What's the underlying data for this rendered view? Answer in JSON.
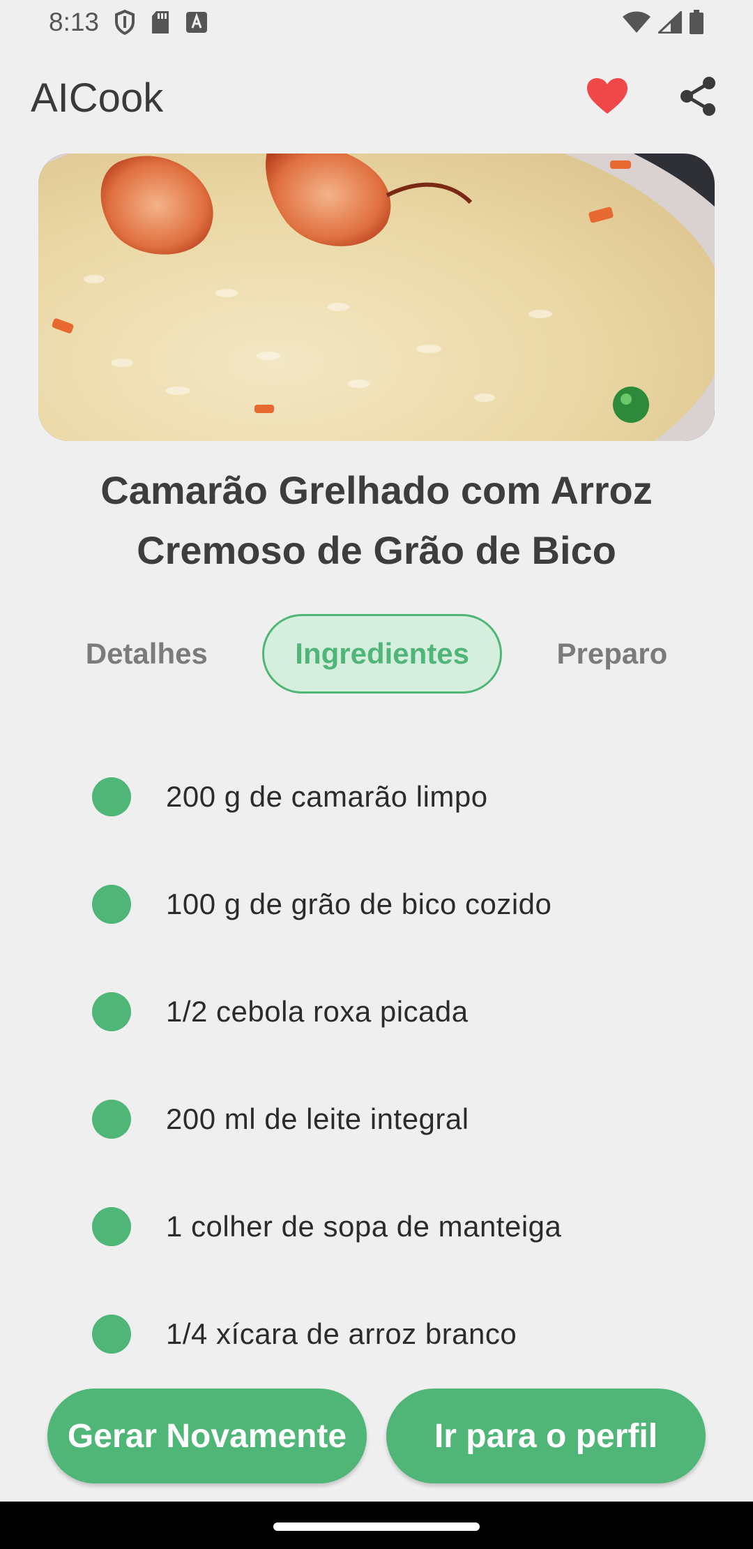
{
  "status_bar": {
    "time": "8:13",
    "icons_left": [
      "shield-icon",
      "sd-card-icon",
      "font-a-icon"
    ],
    "icons_right": [
      "wifi-icon",
      "signal-icon",
      "battery-icon"
    ]
  },
  "app_bar": {
    "title": "AICook",
    "actions": [
      "heart-icon",
      "share-icon"
    ],
    "favorite_color": "#f04848"
  },
  "hero_image": {
    "description": "food-photo"
  },
  "recipe": {
    "title": "Camarão Grelhado com Arroz Cremoso de Grão de Bico"
  },
  "tabs": [
    {
      "label": "Detalhes",
      "active": false
    },
    {
      "label": "Ingredientes",
      "active": true
    },
    {
      "label": "Preparo",
      "active": false
    }
  ],
  "ingredients": [
    "200 g de camarão limpo",
    "100 g de grão de bico cozido",
    "1/2 cebola roxa picada",
    "200 ml de leite integral",
    "1 colher de sopa de manteiga",
    "1/4 xícara de arroz branco"
  ],
  "actions": {
    "regenerate_label": "Gerar Novamente",
    "profile_label": "Ir para o perfil"
  },
  "colors": {
    "accent": "#4fb677",
    "accent_light": "#d6eedd",
    "background": "#efefef"
  }
}
